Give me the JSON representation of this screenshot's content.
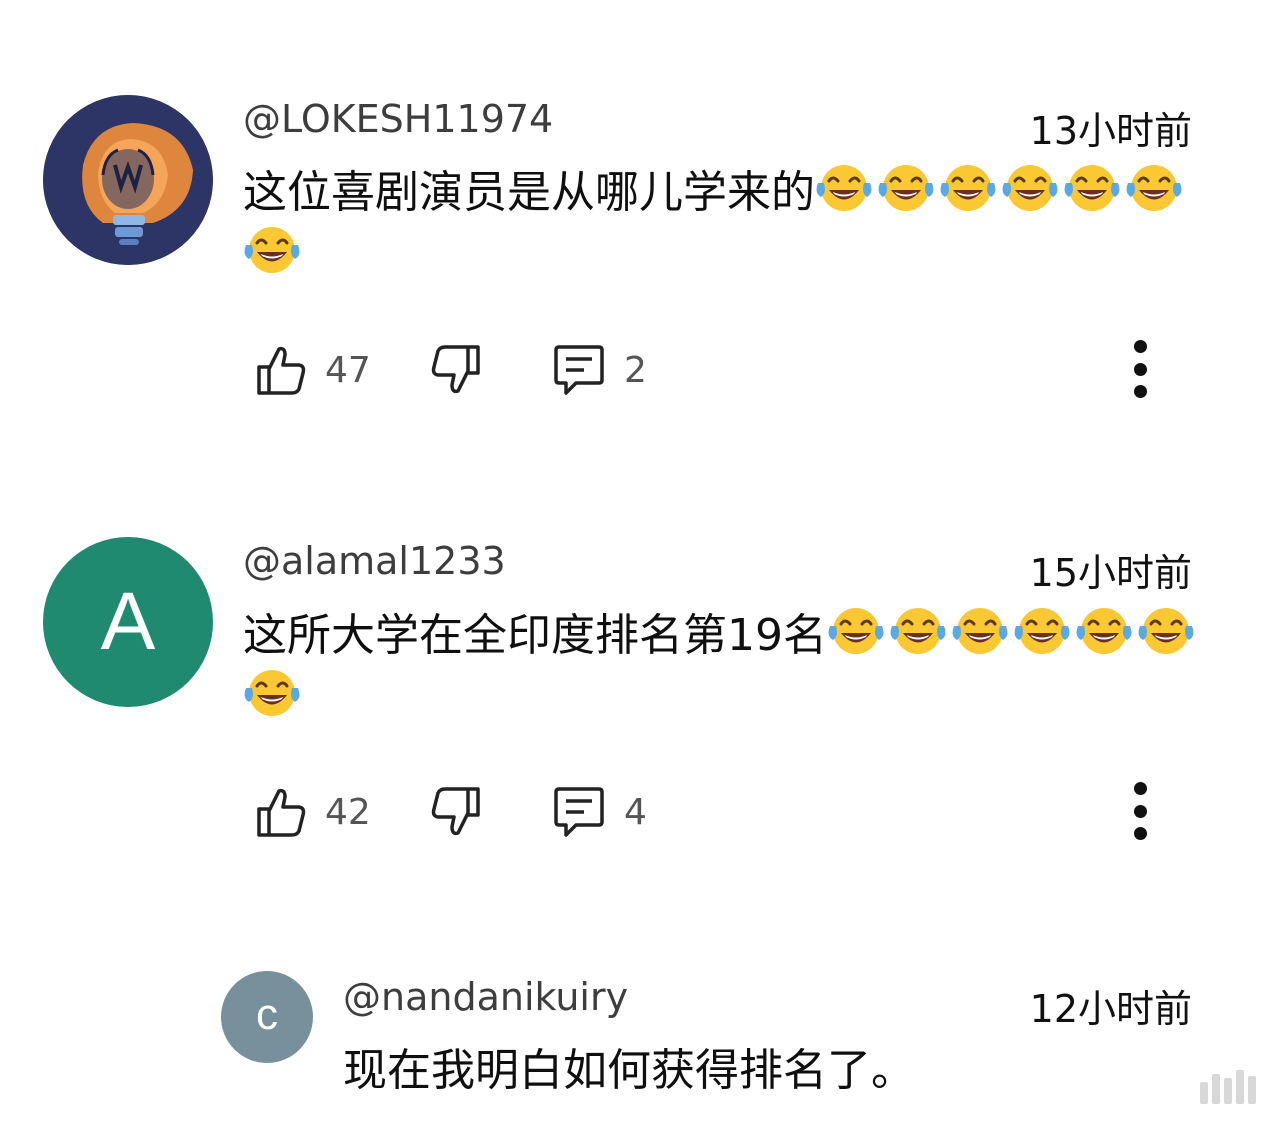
{
  "comments": [
    {
      "author": "@LOKESH11974",
      "time": "13小时前",
      "text": "这位喜剧演员是从哪儿学来的",
      "emoji_count": 7,
      "likes": "47",
      "replies": "2",
      "avatar": {
        "type": "image",
        "icon": "lightbulb-logo",
        "bg": "#2c3566"
      }
    },
    {
      "author": "@alamal1233",
      "time": "15小时前",
      "text": "这所大学在全印度排名第19名",
      "emoji_count": 7,
      "likes": "42",
      "replies": "4",
      "avatar": {
        "type": "letter",
        "letter": "A",
        "bg": "#1f8a70"
      }
    }
  ],
  "reply": {
    "author": "@nandanikuiry",
    "time": "12小时前",
    "text": "现在我明白如何获得排名了。",
    "avatar": {
      "type": "letter",
      "letter": "c",
      "bg": "#78909c"
    }
  },
  "icons": {
    "like": "thumb-up-icon",
    "dislike": "thumb-down-icon",
    "reply": "comment-icon",
    "more": "more-vert-icon",
    "emoji": "face-with-tears-of-joy-emoji"
  },
  "colors": {
    "text": "#0f0f0f",
    "meta": "#555555",
    "emoji_face": "#f9c833",
    "emoji_tear": "#5aa9e6"
  }
}
